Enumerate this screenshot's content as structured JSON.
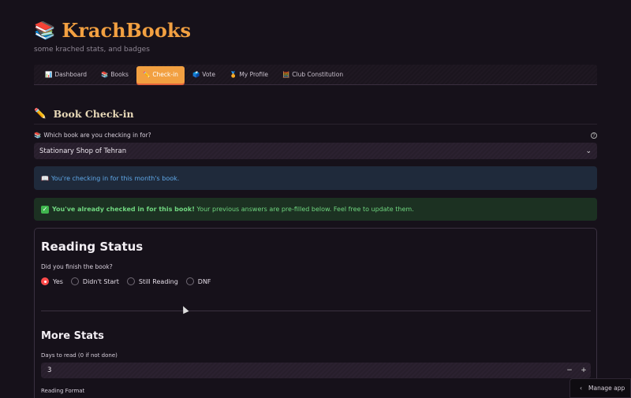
{
  "app": {
    "logo_emoji": "📚",
    "title": "KrachBooks",
    "subtitle": "some krached stats, and badges"
  },
  "tabs": [
    {
      "icon": "📊",
      "label": "Dashboard"
    },
    {
      "icon": "📚",
      "label": "Books"
    },
    {
      "icon": "✏️",
      "label": "Check-in",
      "active": true
    },
    {
      "icon": "🗳️",
      "label": "Vote"
    },
    {
      "icon": "🏅",
      "label": "My Profile"
    },
    {
      "icon": "🧮",
      "label": "Club Constitution"
    }
  ],
  "section": {
    "icon": "✏️",
    "title": "Book Check-in"
  },
  "book_select": {
    "icon": "📚",
    "label": "Which book are you checking in for?",
    "value": "Stationary Shop of Tehran"
  },
  "info": {
    "icon": "📖",
    "text": "You're checking in for this month's book."
  },
  "success": {
    "bold": "You've already checked in for this book!",
    "text": " Your previous answers are pre-filled below. Feel free to update them."
  },
  "reading_status": {
    "heading": "Reading Status",
    "question": "Did you finish the book?",
    "options": [
      "Yes",
      "Didn't Start",
      "Still Reading",
      "DNF"
    ],
    "selected": "Yes"
  },
  "more_stats": {
    "heading": "More Stats",
    "days_label": "Days to read (0 if not done)",
    "days_value": "3",
    "minus": "−",
    "plus": "+",
    "format_label": "Reading Format"
  },
  "manage_app": {
    "label": "Manage app"
  },
  "colors": {
    "accent": "#f2a041",
    "radio_selected": "#ff4b4b",
    "info_text": "#5fa8e8",
    "success_text": "#6fd67f"
  }
}
